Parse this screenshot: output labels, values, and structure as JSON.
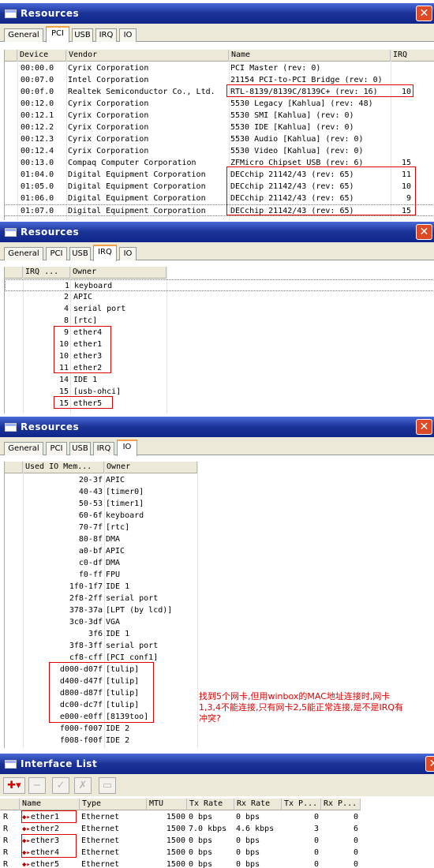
{
  "pci_window": {
    "title": "Resources",
    "tabs": [
      "General",
      "PCI",
      "USB",
      "IRQ",
      "IO"
    ],
    "active_tab": "PCI",
    "columns": [
      "Device",
      "Vendor",
      "Name",
      "IRQ"
    ],
    "rows": [
      {
        "device": "00:00.0",
        "vendor": "Cyrix Corporation",
        "name": "PCI Master (rev: 0)",
        "irq": ""
      },
      {
        "device": "00:07.0",
        "vendor": "Intel Corporation",
        "name": "21154 PCI-to-PCI Bridge (rev: 0)",
        "irq": ""
      },
      {
        "device": "00:0f.0",
        "vendor": "Realtek Semiconductor Co., Ltd.",
        "name": "RTL-8139/8139C/8139C+ (rev: 16)",
        "irq": "10"
      },
      {
        "device": "00:12.0",
        "vendor": "Cyrix Corporation",
        "name": "5530 Legacy [Kahlua] (rev: 48)",
        "irq": ""
      },
      {
        "device": "00:12.1",
        "vendor": "Cyrix Corporation",
        "name": "5530 SMI [Kahlua] (rev: 0)",
        "irq": ""
      },
      {
        "device": "00:12.2",
        "vendor": "Cyrix Corporation",
        "name": "5530 IDE [Kahlua] (rev: 0)",
        "irq": ""
      },
      {
        "device": "00:12.3",
        "vendor": "Cyrix Corporation",
        "name": "5530 Audio [Kahlua] (rev: 0)",
        "irq": ""
      },
      {
        "device": "00:12.4",
        "vendor": "Cyrix Corporation",
        "name": "5530 Video [Kahlua] (rev: 0)",
        "irq": ""
      },
      {
        "device": "00:13.0",
        "vendor": "Compaq Computer Corporation",
        "name": "ZFMicro Chipset USB (rev: 6)",
        "irq": "15"
      },
      {
        "device": "01:04.0",
        "vendor": "Digital Equipment Corporation",
        "name": "DECchip 21142/43 (rev: 65)",
        "irq": "11"
      },
      {
        "device": "01:05.0",
        "vendor": "Digital Equipment Corporation",
        "name": "DECchip 21142/43 (rev: 65)",
        "irq": "10"
      },
      {
        "device": "01:06.0",
        "vendor": "Digital Equipment Corporation",
        "name": "DECchip 21142/43 (rev: 65)",
        "irq": "9"
      },
      {
        "device": "01:07.0",
        "vendor": "Digital Equipment Corporation",
        "name": "DECchip 21142/43 (rev: 65)",
        "irq": "15"
      }
    ]
  },
  "irq_window": {
    "title": "Resources",
    "tabs": [
      "General",
      "PCI",
      "USB",
      "IRQ",
      "IO"
    ],
    "active_tab": "IRQ",
    "columns": [
      "IRQ ...",
      "Owner"
    ],
    "rows": [
      {
        "irq": "1",
        "owner": "keyboard"
      },
      {
        "irq": "2",
        "owner": "APIC"
      },
      {
        "irq": "4",
        "owner": "serial port"
      },
      {
        "irq": "8",
        "owner": "[rtc]"
      },
      {
        "irq": "9",
        "owner": "ether4"
      },
      {
        "irq": "10",
        "owner": "ether1"
      },
      {
        "irq": "10",
        "owner": "ether3"
      },
      {
        "irq": "11",
        "owner": "ether2"
      },
      {
        "irq": "14",
        "owner": "IDE 1"
      },
      {
        "irq": "15",
        "owner": "[usb-ohci]"
      },
      {
        "irq": "15",
        "owner": "ether5"
      }
    ]
  },
  "io_window": {
    "title": "Resources",
    "tabs": [
      "General",
      "PCI",
      "USB",
      "IRQ",
      "IO"
    ],
    "active_tab": "IO",
    "columns": [
      "Used IO Mem...",
      "Owner"
    ],
    "rows": [
      {
        "range": "20-3f",
        "owner": "APIC"
      },
      {
        "range": "40-43",
        "owner": "[timer0]"
      },
      {
        "range": "50-53",
        "owner": "[timer1]"
      },
      {
        "range": "60-6f",
        "owner": "keyboard"
      },
      {
        "range": "70-7f",
        "owner": "[rtc]"
      },
      {
        "range": "80-8f",
        "owner": "DMA"
      },
      {
        "range": "a0-bf",
        "owner": "APIC"
      },
      {
        "range": "c0-df",
        "owner": "DMA"
      },
      {
        "range": "f0-ff",
        "owner": "FPU"
      },
      {
        "range": "1f0-1f7",
        "owner": "IDE 1"
      },
      {
        "range": "2f8-2ff",
        "owner": "serial port"
      },
      {
        "range": "378-37a",
        "owner": "[LPT (by lcd)]"
      },
      {
        "range": "3c0-3df",
        "owner": "VGA"
      },
      {
        "range": "3f6",
        "owner": "IDE 1"
      },
      {
        "range": "3f8-3ff",
        "owner": "serial port"
      },
      {
        "range": "cf8-cff",
        "owner": "[PCI conf1]"
      },
      {
        "range": "d000-d07f",
        "owner": "[tulip]"
      },
      {
        "range": "d400-d47f",
        "owner": "[tulip]"
      },
      {
        "range": "d800-d87f",
        "owner": "[tulip]"
      },
      {
        "range": "dc00-dc7f",
        "owner": "[tulip]"
      },
      {
        "range": "e000-e0ff",
        "owner": "[8139too]"
      },
      {
        "range": "f000-f007",
        "owner": "IDE 2"
      },
      {
        "range": "f008-f00f",
        "owner": "IDE 2"
      }
    ]
  },
  "annotation_note": "找到5个网卡,但用winbox的MAC地址连接时,网卡1,3,4不能连接,只有网卡2,5能正常连接,是不是IRQ有冲突?",
  "interface_window": {
    "title": "Interface List",
    "toolbar": [
      "add-icon",
      "remove-icon",
      "enable-icon",
      "disable-icon",
      "comment-icon"
    ],
    "columns": [
      "Name",
      "Type",
      "MTU",
      "Tx Rate",
      "Rx Rate",
      "Tx P...",
      "Rx P..."
    ],
    "rows": [
      {
        "flag": "R",
        "name": "ether1",
        "type": "Ethernet",
        "mtu": "1500",
        "tx_rate": "0 bps",
        "rx_rate": "0 bps",
        "tx_p": "0",
        "rx_p": "0"
      },
      {
        "flag": "R",
        "name": "ether2",
        "type": "Ethernet",
        "mtu": "1500",
        "tx_rate": "7.0 kbps",
        "rx_rate": "4.6 kbps",
        "tx_p": "3",
        "rx_p": "6"
      },
      {
        "flag": "R",
        "name": "ether3",
        "type": "Ethernet",
        "mtu": "1500",
        "tx_rate": "0 bps",
        "rx_rate": "0 bps",
        "tx_p": "0",
        "rx_p": "0"
      },
      {
        "flag": "R",
        "name": "ether4",
        "type": "Ethernet",
        "mtu": "1500",
        "tx_rate": "0 bps",
        "rx_rate": "0 bps",
        "tx_p": "0",
        "rx_p": "0"
      },
      {
        "flag": "R",
        "name": "ether5",
        "type": "Ethernet",
        "mtu": "1500",
        "tx_rate": "0 bps",
        "rx_rate": "0 bps",
        "tx_p": "0",
        "rx_p": "0"
      }
    ]
  }
}
